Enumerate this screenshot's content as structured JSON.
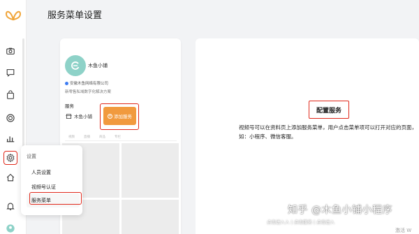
{
  "header": {
    "title": "服务菜单设置"
  },
  "sidebar": {
    "icons": [
      "butterfly-logo-icon",
      "camera-icon",
      "chat-icon",
      "bag-icon",
      "target-icon",
      "bar-chart-icon",
      "gear-icon",
      "home-icon",
      "bell-icon",
      "user-icon"
    ]
  },
  "preview": {
    "shop_name": "木鱼小铺",
    "company": "安徽木鱼网络有限公司",
    "description": "新零售私域数字化解决方案",
    "services_label": "服务",
    "service_chip": "木鱼小铺",
    "add_button": "添加服务",
    "tabs": [
      "视频",
      "直播",
      "商品",
      "专栏"
    ]
  },
  "config": {
    "title": "配置服务",
    "description": "视频号可以在资料页上添加服务菜单，用户点击菜单项可以打开对应的页面，如：小程序、微信客服。"
  },
  "settings_menu": {
    "caption": "设置",
    "items": [
      "人员设置",
      "视频号认证",
      "服务菜单"
    ],
    "selected": "服务菜单"
  },
  "watermark": {
    "text": "知乎 @木鱼小铺小程序",
    "sub": "点击进入入 | 点击服务 | 点击进入"
  },
  "os_notice": "激活 W",
  "colors": {
    "highlight": "#e0281a",
    "accent": "#f19a3e",
    "avatar": "#8ed2c8"
  }
}
